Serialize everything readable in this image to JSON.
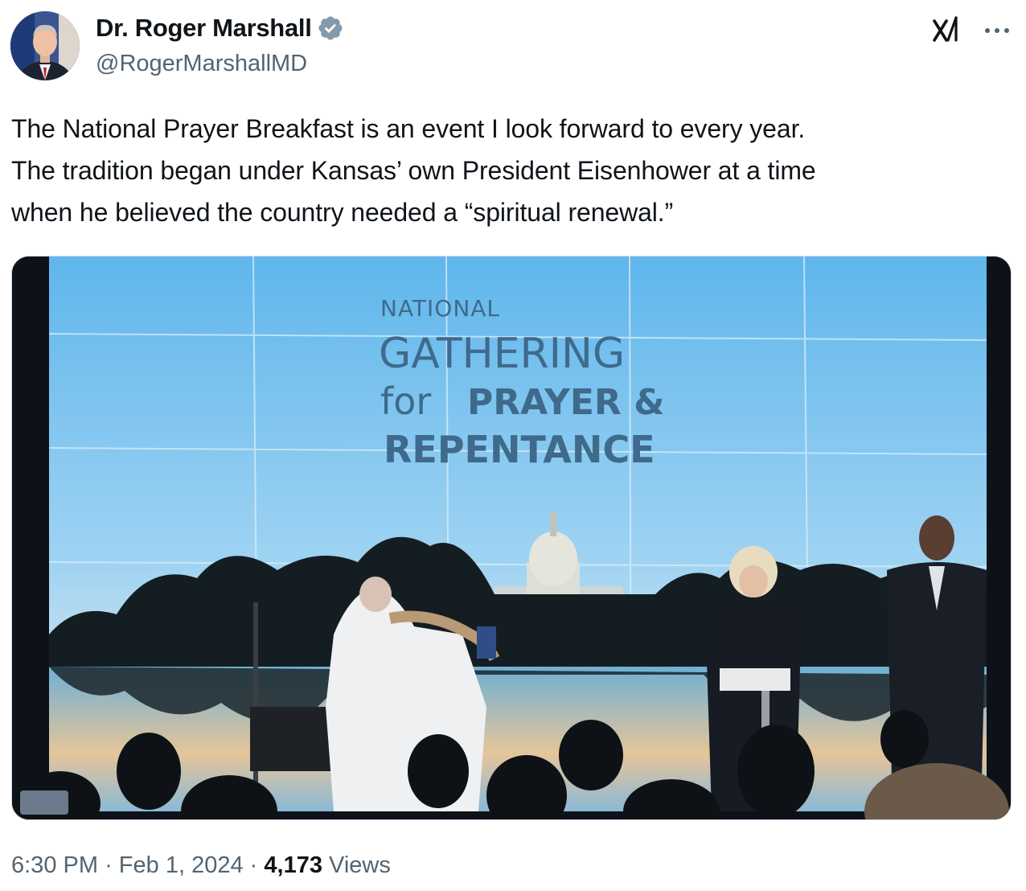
{
  "author": {
    "display_name": "Dr. Roger Marshall",
    "handle": "@RogerMarshallMD",
    "verified": true
  },
  "tweet": {
    "text": "The National Prayer Breakfast is an event I look forward to every year.\nThe tradition began under Kansas’ own President Eisenhower at a time\nwhen he believed the country needed a “spiritual renewal.”"
  },
  "media": {
    "screen_text": {
      "line1": "NATIONAL",
      "line2": "GATHERING",
      "line3_light": "for",
      "line3_bold": "PRAYER &",
      "line4": "REPENTANCE"
    }
  },
  "meta": {
    "time": "6:30 PM",
    "separator": "·",
    "date": "Feb 1, 2024",
    "views_count": "4,173",
    "views_label": "Views"
  },
  "icons": {
    "verified": "verified-badge-icon",
    "grok": "grok-icon",
    "more": "more-options-icon"
  },
  "colors": {
    "verified": "#829aab",
    "secondary_text": "#536471",
    "primary_text": "#0f1419"
  }
}
